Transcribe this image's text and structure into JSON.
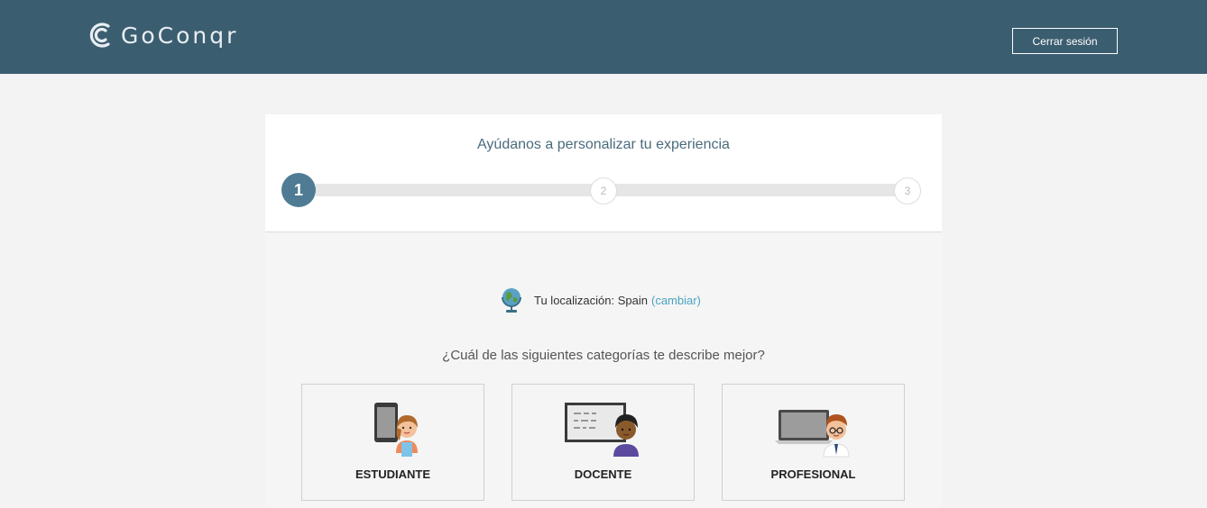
{
  "header": {
    "brand": "GoConqr",
    "logout_label": "Cerrar sesión"
  },
  "wizard": {
    "title": "Ayúdanos a personalizar tu experiencia",
    "steps": [
      "1",
      "2",
      "3"
    ],
    "current_step": 1
  },
  "location": {
    "label": "Tu localización: Spain",
    "change_link": "(cambiar)"
  },
  "question": "¿Cuál de las siguientes categorías te describe mejor?",
  "categories": [
    {
      "label": "ESTUDIANTE",
      "icon": "student-tablet-icon"
    },
    {
      "label": "DOCENTE",
      "icon": "teacher-whiteboard-icon"
    },
    {
      "label": "PROFESIONAL",
      "icon": "professional-laptop-icon"
    }
  ],
  "colors": {
    "header_bg": "#3b5d70",
    "step_active": "#4f7c94",
    "link": "#4aa3c0",
    "title": "#4a6b7c"
  }
}
